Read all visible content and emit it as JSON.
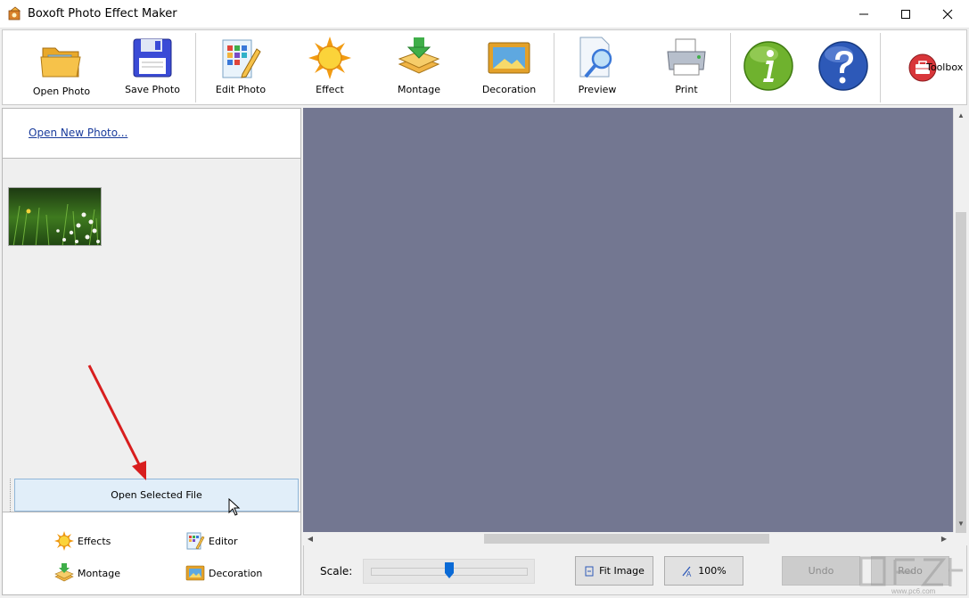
{
  "window": {
    "title": "Boxoft Photo Effect Maker",
    "controls": [
      "minimize",
      "maximize",
      "close"
    ]
  },
  "toolbar": {
    "open_photo": "Open Photo",
    "save_photo": "Save Photo",
    "edit_photo": "Edit Photo",
    "effect": "Effect",
    "montage": "Montage",
    "decoration": "Decoration",
    "preview": "Preview",
    "print": "Print",
    "toolbox": "Toolbox"
  },
  "left_panel": {
    "open_new_link": "Open New Photo...",
    "thumbnail_icon": "photo-thumbnail",
    "open_selected_button": "Open Selected File",
    "tabs": {
      "effects": "Effects",
      "editor": "Editor",
      "montage": "Montage",
      "decoration": "Decoration"
    }
  },
  "bottom_bar": {
    "scale_label": "Scale:",
    "scale_value_fraction": 0.5,
    "fit_image": "Fit Image",
    "zoom_100": "100%",
    "undo": "Undo",
    "redo": "Redo"
  },
  "colors": {
    "canvas_background": "#737791",
    "link": "#1a3c9c",
    "selected_button_bg": "#e1eef9",
    "annotation_arrow": "#d81e1e"
  },
  "watermark": {
    "text": "www.pc6.com"
  }
}
